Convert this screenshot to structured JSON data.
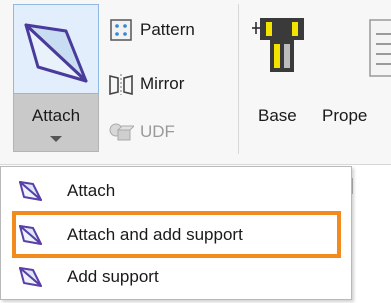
{
  "ribbon": {
    "attach": {
      "label": "Attach",
      "icon": "attach-triangle-icon"
    },
    "pattern": {
      "label": "Pattern",
      "icon": "pattern-grid-icon"
    },
    "mirror": {
      "label": "Mirror",
      "icon": "mirror-icon"
    },
    "udf": {
      "label": "UDF",
      "icon": "udf-cube-icon",
      "disabled": true
    },
    "base": {
      "label": "Base",
      "icon": "base-fixture-icon"
    },
    "properties": {
      "label": "Prope",
      "icon": "properties-doc-icon"
    }
  },
  "menu": {
    "items": [
      {
        "label": "Attach",
        "icon": "attach-triangle-icon"
      },
      {
        "label": "Attach and add support",
        "icon": "attach-triangle-icon",
        "highlighted": true
      },
      {
        "label": "Add support",
        "icon": "attach-triangle-icon"
      }
    ]
  },
  "colors": {
    "highlight_border": "#f28a1d",
    "icon_purple": "#5a3fa8",
    "icon_blue": "#2f86d6"
  }
}
